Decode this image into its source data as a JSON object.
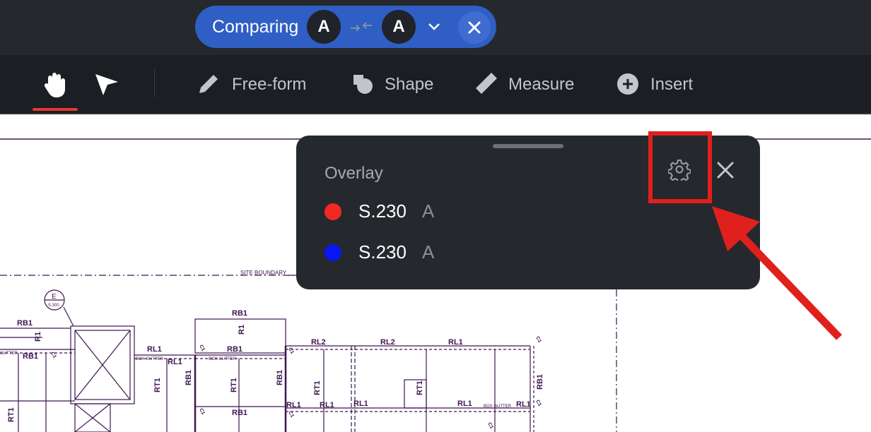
{
  "compare_bar": {
    "label": "Comparing",
    "version_a": "A",
    "version_b": "A"
  },
  "toolbar": {
    "tools": [
      {
        "label": "Free-form",
        "icon": "pen-icon"
      },
      {
        "label": "Shape",
        "icon": "shape-icon"
      },
      {
        "label": "Measure",
        "icon": "ruler-icon"
      },
      {
        "label": "Insert",
        "icon": "plus-circle-icon"
      }
    ],
    "active_tool": "hand-icon"
  },
  "overlay": {
    "title": "Overlay",
    "rows": [
      {
        "sheet": "S.230",
        "revision": "A",
        "color": "#f02a22"
      },
      {
        "sheet": "S.230",
        "revision": "A",
        "color": "#0a17f2"
      }
    ]
  },
  "drawing": {
    "site_boundary_label": "SITE BOUNDARY",
    "section_marker_letter": "E",
    "section_marker_ref": "S.300",
    "labels": {
      "rb1": "RB1",
      "r1": "R1",
      "rl1": "RL1",
      "rl2": "RL2",
      "rt1": "RT1",
      "box_gutter": "BOX GUTTER",
      "gutter": "GUTTER",
      "c1": "C1"
    }
  },
  "colors": {
    "accent_blue": "#2f5fc4",
    "highlight_red": "#e0201c",
    "drawing_line": "#3d1650"
  }
}
